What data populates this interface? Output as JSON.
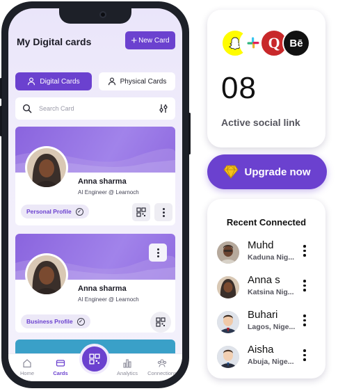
{
  "app": {
    "title": "My Digital cards",
    "new_card_label": "New Card"
  },
  "tabs": [
    {
      "label": "Digital Cards",
      "active": true
    },
    {
      "label": "Physical Cards",
      "active": false
    }
  ],
  "search": {
    "placeholder": "Search Card"
  },
  "cards": [
    {
      "name": "Anna sharma",
      "role": "AI Engineer @ Learnoch",
      "profile_label": "Personal Profile"
    },
    {
      "name": "Anna sharma",
      "role": "AI Engineer @ Learnoch",
      "profile_label": "Business Profile"
    }
  ],
  "bottom_nav": [
    {
      "label": "Home",
      "icon": "home-icon",
      "active": false
    },
    {
      "label": "Cards",
      "icon": "card-icon",
      "active": true
    },
    {
      "label": "Analytics",
      "icon": "analytics-icon",
      "active": false
    },
    {
      "label": "Connections",
      "icon": "connections-icon",
      "active": false
    }
  ],
  "social_panel": {
    "logos": [
      "snapchat-logo",
      "slack-logo",
      "quora-logo",
      "behance-logo"
    ],
    "count": "08",
    "label": "Active social link"
  },
  "upgrade": {
    "label": "Upgrade now",
    "icon": "diamond-icon"
  },
  "recent": {
    "title": "Recent Connected",
    "people": [
      {
        "name": "Muhd",
        "location": "Kaduna Nig..."
      },
      {
        "name": "Anna s",
        "location": "Katsina Nig..."
      },
      {
        "name": "Buhari",
        "location": "Lagos, Nige..."
      },
      {
        "name": "Aisha",
        "location": "Abuja, Nige..."
      }
    ]
  },
  "colors": {
    "accent": "#6b41cf",
    "banner": "#8a64de",
    "phone_frame": "#1d2028"
  }
}
